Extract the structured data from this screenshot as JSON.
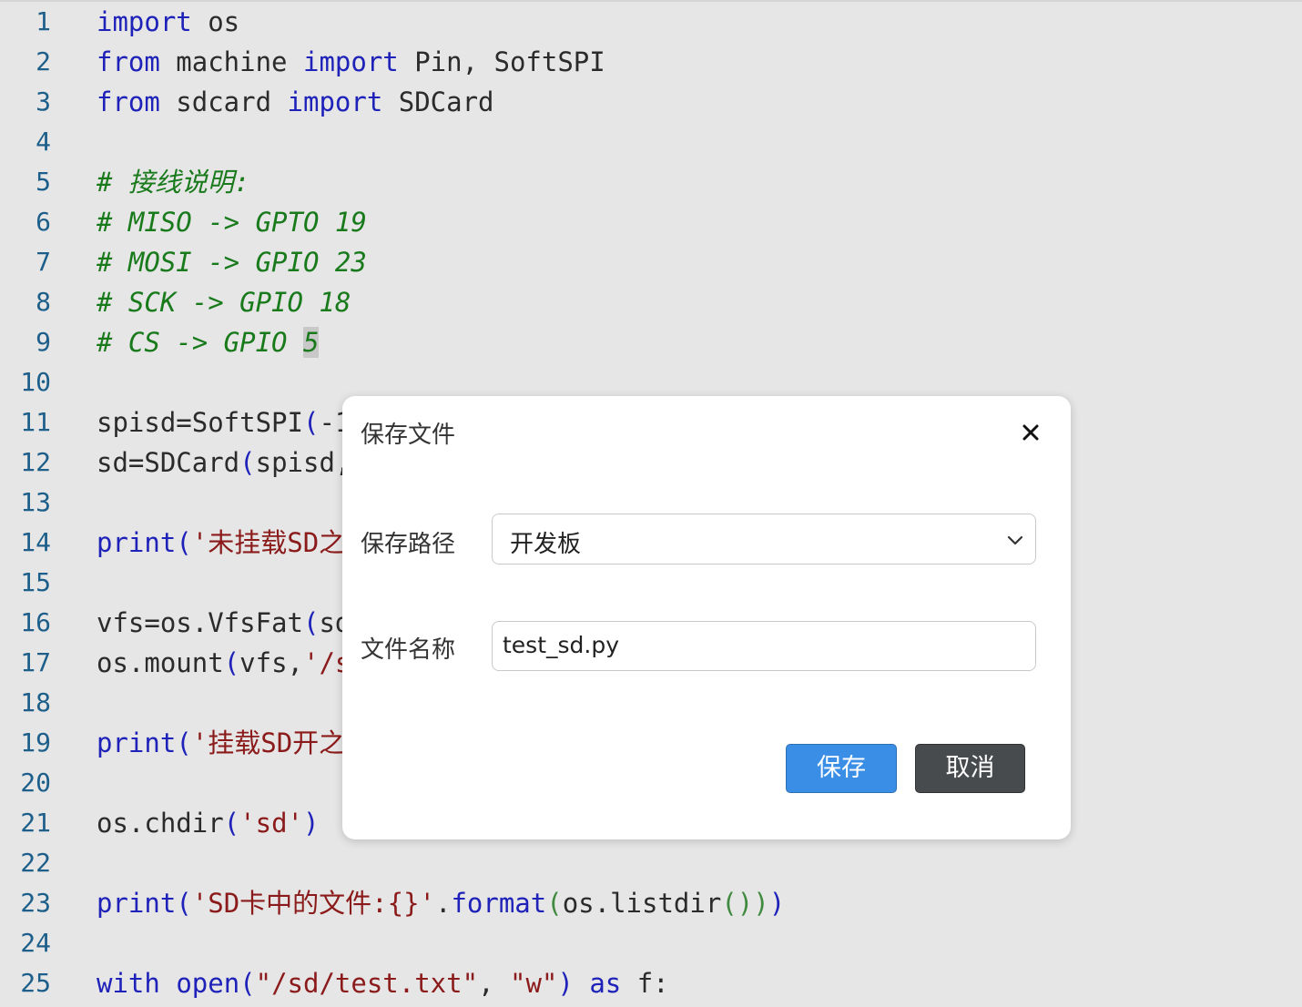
{
  "editor": {
    "line_numbers": [
      "1",
      "2",
      "3",
      "4",
      "5",
      "6",
      "7",
      "8",
      "9",
      "10",
      "11",
      "12",
      "13",
      "14",
      "15",
      "16",
      "17",
      "18",
      "19",
      "20",
      "21",
      "22",
      "23",
      "24",
      "25"
    ],
    "lines": [
      [
        {
          "t": "import",
          "c": "kw"
        },
        {
          "t": " os",
          "c": "id"
        }
      ],
      [
        {
          "t": "from",
          "c": "kw"
        },
        {
          "t": " machine ",
          "c": "id"
        },
        {
          "t": "import",
          "c": "kw"
        },
        {
          "t": " Pin, SoftSPI",
          "c": "id"
        }
      ],
      [
        {
          "t": "from",
          "c": "kw"
        },
        {
          "t": " sdcard ",
          "c": "id"
        },
        {
          "t": "import",
          "c": "kw"
        },
        {
          "t": " SDCard",
          "c": "id"
        }
      ],
      [],
      [
        {
          "t": "# 接线说明:",
          "c": "cm"
        }
      ],
      [
        {
          "t": "# MISO -> GPTO 19",
          "c": "cm"
        }
      ],
      [
        {
          "t": "# MOSI -> GPIO 23",
          "c": "cm"
        }
      ],
      [
        {
          "t": "# SCK -> GPIO 18",
          "c": "cm"
        }
      ],
      [
        {
          "t": "# CS -> GPIO ",
          "c": "cm"
        },
        {
          "t": "5",
          "c": "cm hl"
        }
      ],
      [],
      [
        {
          "t": "spisd=SoftSPI",
          "c": "id"
        },
        {
          "t": "(",
          "c": "paren"
        },
        {
          "t": "-1",
          "c": "id"
        }
      ],
      [
        {
          "t": "sd=SDCard",
          "c": "id"
        },
        {
          "t": "(",
          "c": "paren"
        },
        {
          "t": "spisd,",
          "c": "id"
        }
      ],
      [],
      [
        {
          "t": "print",
          "c": "kw"
        },
        {
          "t": "(",
          "c": "paren"
        },
        {
          "t": "'未挂载SD之",
          "c": "str"
        }
      ],
      [],
      [
        {
          "t": "vfs=os.VfsFat",
          "c": "id"
        },
        {
          "t": "(",
          "c": "paren"
        },
        {
          "t": "sd",
          "c": "id"
        }
      ],
      [
        {
          "t": "os.mount",
          "c": "id"
        },
        {
          "t": "(",
          "c": "paren"
        },
        {
          "t": "vfs,",
          "c": "id"
        },
        {
          "t": "'/s",
          "c": "str"
        }
      ],
      [],
      [
        {
          "t": "print",
          "c": "kw"
        },
        {
          "t": "(",
          "c": "paren"
        },
        {
          "t": "'挂载SD开之",
          "c": "str"
        }
      ],
      [],
      [
        {
          "t": "os.chdir",
          "c": "id"
        },
        {
          "t": "(",
          "c": "paren"
        },
        {
          "t": "'sd'",
          "c": "str"
        },
        {
          "t": ")",
          "c": "paren"
        }
      ],
      [],
      [
        {
          "t": "print",
          "c": "kw"
        },
        {
          "t": "(",
          "c": "paren"
        },
        {
          "t": "'SD卡中的文件:{}'",
          "c": "str"
        },
        {
          "t": ".",
          "c": "id"
        },
        {
          "t": "format",
          "c": "kw"
        },
        {
          "t": "(",
          "c": "paren2"
        },
        {
          "t": "os.listdir",
          "c": "id"
        },
        {
          "t": "()",
          "c": "paren2"
        },
        {
          "t": ")",
          "c": "paren2"
        },
        {
          "t": ")",
          "c": "paren"
        }
      ],
      [],
      [
        {
          "t": "with",
          "c": "kw"
        },
        {
          "t": " ",
          "c": "id"
        },
        {
          "t": "open",
          "c": "kw"
        },
        {
          "t": "(",
          "c": "paren"
        },
        {
          "t": "\"/sd/test.txt\"",
          "c": "str"
        },
        {
          "t": ", ",
          "c": "id"
        },
        {
          "t": "\"w\"",
          "c": "str"
        },
        {
          "t": ")",
          "c": "paren"
        },
        {
          "t": " ",
          "c": "id"
        },
        {
          "t": "as",
          "c": "kw"
        },
        {
          "t": " f:",
          "c": "id"
        }
      ]
    ]
  },
  "dialog": {
    "title": "保存文件",
    "close_icon": "close-icon",
    "path_label": "保存路径",
    "path_value": "开发板",
    "name_label": "文件名称",
    "name_value": "test_sd.py",
    "save_label": "保存",
    "cancel_label": "取消"
  },
  "colors": {
    "keyword": "#1e22b9",
    "comment": "#197a1c",
    "string": "#8b1a1a",
    "line_number": "#1d5f8a",
    "save_button": "#3a8ee6",
    "cancel_button": "#484b4e"
  }
}
